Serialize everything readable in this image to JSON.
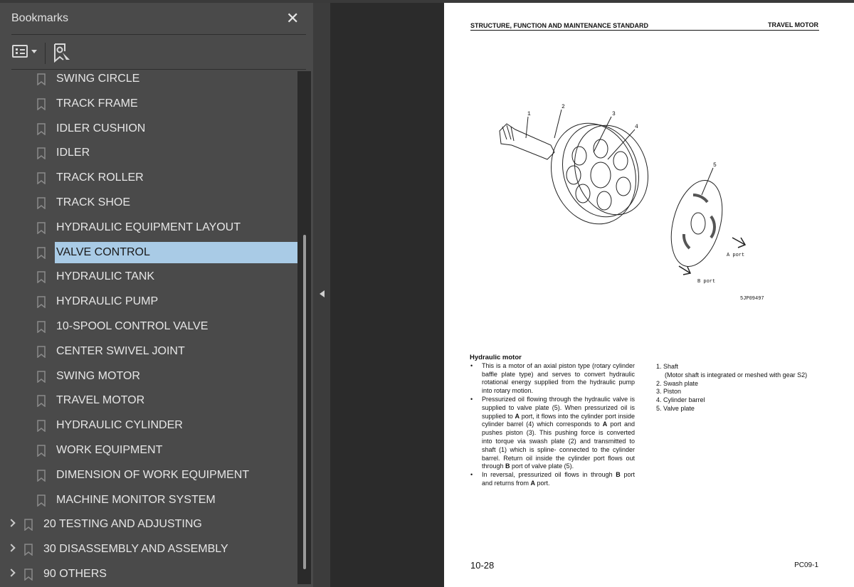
{
  "sidebar": {
    "title": "Bookmarks",
    "items": [
      {
        "label": "SWING CIRCLE",
        "level": 2
      },
      {
        "label": "TRACK FRAME",
        "level": 2
      },
      {
        "label": "IDLER CUSHION",
        "level": 2
      },
      {
        "label": "IDLER",
        "level": 2
      },
      {
        "label": "TRACK ROLLER",
        "level": 2
      },
      {
        "label": "TRACK SHOE",
        "level": 2
      },
      {
        "label": "HYDRAULIC EQUIPMENT LAYOUT",
        "level": 2
      },
      {
        "label": "VALVE CONTROL",
        "level": 2,
        "selected": true
      },
      {
        "label": "HYDRAULIC TANK",
        "level": 2
      },
      {
        "label": "HYDRAULIC PUMP",
        "level": 2
      },
      {
        "label": "10-SPOOL CONTROL VALVE",
        "level": 2
      },
      {
        "label": "CENTER SWIVEL JOINT",
        "level": 2
      },
      {
        "label": "SWING MOTOR",
        "level": 2
      },
      {
        "label": "TRAVEL MOTOR",
        "level": 2
      },
      {
        "label": "HYDRAULIC CYLINDER",
        "level": 2
      },
      {
        "label": "WORK EQUIPMENT",
        "level": 2
      },
      {
        "label": "DIMENSION OF WORK EQUIPMENT",
        "level": 2
      },
      {
        "label": "MACHINE MONITOR SYSTEM",
        "level": 2
      },
      {
        "label": "20 TESTING AND ADJUSTING",
        "level": 1
      },
      {
        "label": "30 DISASSEMBLY AND ASSEMBLY",
        "level": 1
      },
      {
        "label": "90 OTHERS",
        "level": 1
      }
    ],
    "selected_color": "#a9cbe6"
  },
  "page": {
    "header_left": "STRUCTURE, FUNCTION AND MAINTENANCE STANDARD",
    "header_right": "TRAVEL MOTOR",
    "figure": {
      "callouts": [
        "1",
        "2",
        "3",
        "4",
        "5"
      ],
      "a_port": "A port",
      "b_port": "B port",
      "code": "5JP09497"
    },
    "section_title": "Hydraulic motor",
    "bullets": [
      "This is a motor of an axial piston type (rotary cylinder baffle plate type) and serves to convert hydraulic rotational energy supplied from the hydraulic pump into rotary motion.",
      "Pressurized oil flowing through the hydraulic valve is supplied to valve plate (5). When pressurized oil is supplied to <b>A</b> port, it flows into the cylinder port inside cylinder barrel (4) which corresponds to <b>A</b> port and pushes piston (3). This pushing force is converted into torque via swash plate (2) and transmitted to shaft (1) which is spline- connected to the cylinder barrel. Return oil inside the cylinder port flows out through <b>B</b> port of valve plate (5).",
      "In reversal, pressurized oil flows in through <b>B</b> port and returns from <b>A</b> port."
    ],
    "legend": [
      "1. Shaft",
      "(Motor shaft is integrated or meshed with gear S2)",
      "2. Swash plate",
      "3. Piston",
      "4. Cylinder barrel",
      "5. Valve plate"
    ],
    "page_number": "10-28",
    "model_code": "PC09-1"
  }
}
